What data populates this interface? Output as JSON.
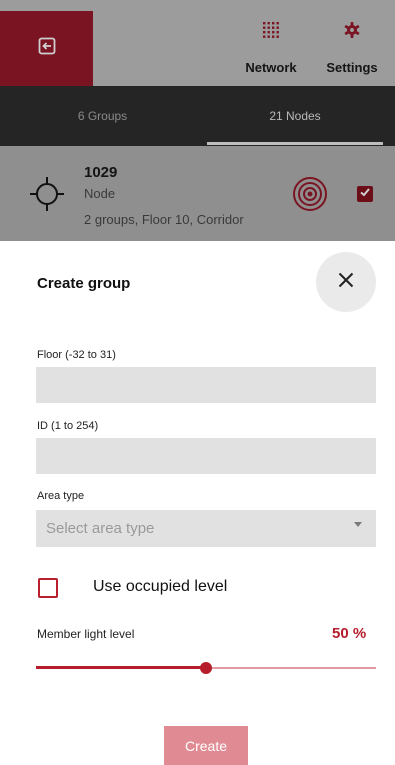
{
  "header": {
    "nav": [
      {
        "label": "Network",
        "icon": "grid-icon"
      },
      {
        "label": "Settings",
        "icon": "gear-icon"
      }
    ],
    "exit_icon": "exit-icon"
  },
  "tabs": [
    {
      "label": "6 Groups",
      "selected": false
    },
    {
      "label": "21 Nodes",
      "selected": true
    }
  ],
  "node_card": {
    "id": "1029",
    "type": "Node",
    "details": "2 groups, Floor 10, Corridor",
    "checked": true
  },
  "dialog": {
    "title": "Create group",
    "floor": {
      "label": "Floor (-32 to 31)",
      "value": ""
    },
    "id_field": {
      "label": "ID (1 to 254)",
      "value": ""
    },
    "area_type": {
      "label": "Area type",
      "placeholder": "Select area type"
    },
    "use_occupied_level": {
      "label": "Use occupied level",
      "checked": false
    },
    "member_light_level": {
      "label": "Member light level",
      "value_text": "50 %",
      "value": 0.5
    },
    "create_label": "Create"
  },
  "colors": {
    "accent": "#b51d2c",
    "accent_dark": "#7a1422",
    "accent_light": "#e08b94",
    "field_bg": "#e1e1e1"
  }
}
